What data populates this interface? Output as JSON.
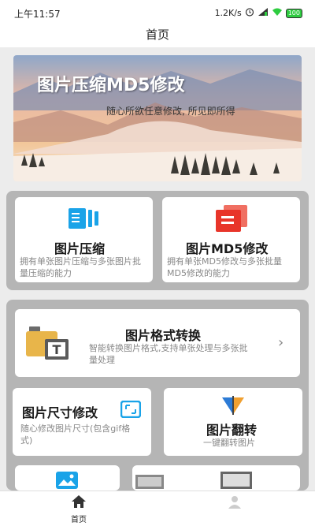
{
  "status_bar": {
    "time": "上午11:57",
    "network_speed": "1.2K/s",
    "battery": "100"
  },
  "header": {
    "title": "首页"
  },
  "banner": {
    "title": "图片压缩MD5修改",
    "subtitle": "随心所欲任意修改, 所见即所得"
  },
  "cards": {
    "compress": {
      "title": "图片压缩",
      "desc": "拥有单张图片压缩与多张图片批量压缩的能力"
    },
    "md5": {
      "title": "图片MD5修改",
      "desc": "拥有单张MD5修改与多张批量MD5修改的能力"
    },
    "format": {
      "title": "图片格式转换",
      "desc": "智能转换图片格式,支持单张处理与多张批量处理"
    },
    "resize": {
      "title": "图片尺寸修改",
      "desc": "随心修改图片尺寸(包含gif格式)"
    },
    "flip": {
      "title": "图片翻转",
      "desc": "一键翻转图片"
    }
  },
  "nav": {
    "home": "首页"
  },
  "colors": {
    "compress_icon": "#1aa3e8",
    "md5_icon": "#e8352a",
    "format_icon": "#e8b54a",
    "panel_bg": "#b5b5b5"
  }
}
